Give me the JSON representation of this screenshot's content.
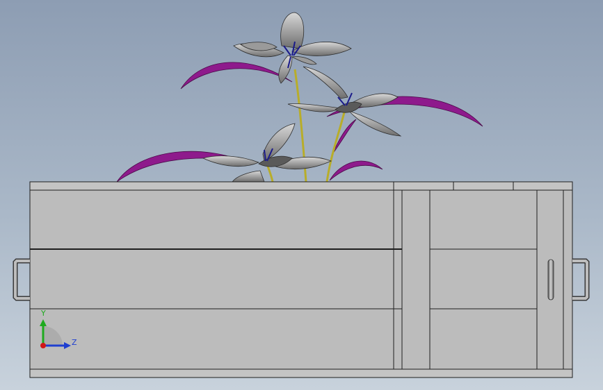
{
  "viewport": {
    "background_top": "#8d9db3",
    "background_bottom": "#c8d2dc"
  },
  "model": {
    "planter_color": "#bcbcbc",
    "edge_color": "#1e1e1e",
    "leaf_color": "#8e1a8c",
    "stem_color": "#b8ad2a",
    "petal_color": "#8c8c8c",
    "stamen_color": "#1a1a8a",
    "handle_color": "#8a8a8a"
  },
  "triad": {
    "y_label": "Y",
    "z_label": "Z",
    "y_color": "#1faa1f",
    "z_color": "#1f3fd0",
    "origin_color": "#d01818"
  }
}
